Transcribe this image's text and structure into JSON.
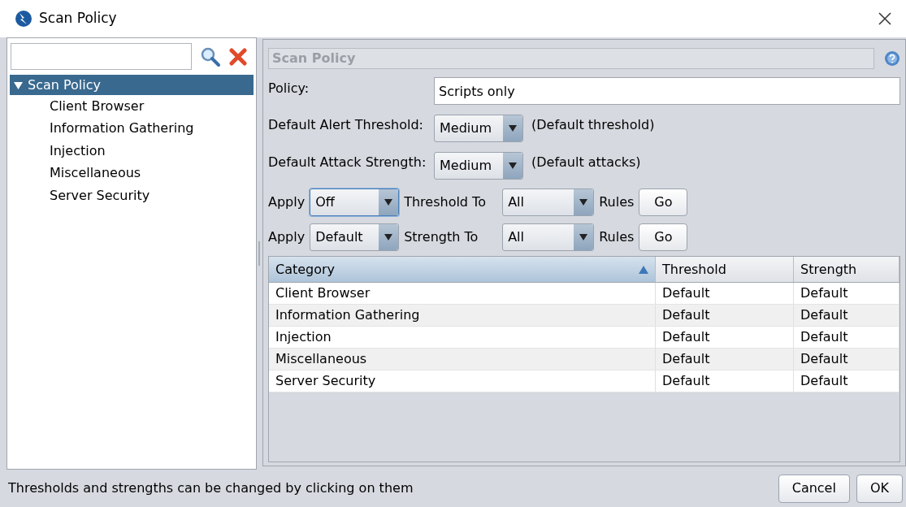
{
  "window": {
    "title": "Scan Policy"
  },
  "tree": [
    {
      "label": "Scan Policy",
      "expanded": true,
      "selected": true,
      "children": [
        {
          "label": "Client Browser",
          "selected": false
        },
        {
          "label": "Information Gathering",
          "selected": false
        },
        {
          "label": "Injection",
          "selected": false
        },
        {
          "label": "Miscellaneous",
          "selected": false
        },
        {
          "label": "Server Security",
          "selected": false
        }
      ]
    }
  ],
  "panel": {
    "title": "Scan Policy"
  },
  "policy": {
    "label": "Policy:",
    "value": "Scripts only"
  },
  "defaults": [
    {
      "label": "Default Alert Threshold:",
      "value": "Medium",
      "note": "(Default threshold)"
    },
    {
      "label": "Default Attack Strength:",
      "value": "Medium",
      "note": "(Default attacks)"
    }
  ],
  "apply_rows": [
    {
      "apply": "Apply",
      "value": "Off",
      "focused": true,
      "middle": "Threshold To",
      "target": "All",
      "rules": "Rules",
      "button": "Go"
    },
    {
      "apply": "Apply",
      "value": "Default",
      "focused": false,
      "middle": "Strength To",
      "target": "All",
      "rules": "Rules",
      "button": "Go"
    }
  ],
  "table": {
    "columns": [
      {
        "label": "Category",
        "sorted": true
      },
      {
        "label": "Threshold",
        "sorted": false
      },
      {
        "label": "Strength",
        "sorted": false
      }
    ],
    "rows": [
      [
        "Client Browser",
        "Default",
        "Default"
      ],
      [
        "Information Gathering",
        "Default",
        "Default"
      ],
      [
        "Injection",
        "Default",
        "Default"
      ],
      [
        "Miscellaneous",
        "Default",
        "Default"
      ],
      [
        "Server Security",
        "Default",
        "Default"
      ]
    ]
  },
  "status_bar": {
    "text": "Thresholds and strengths can be changed by clicking on them"
  },
  "buttons": [
    "Cancel",
    "OK"
  ]
}
